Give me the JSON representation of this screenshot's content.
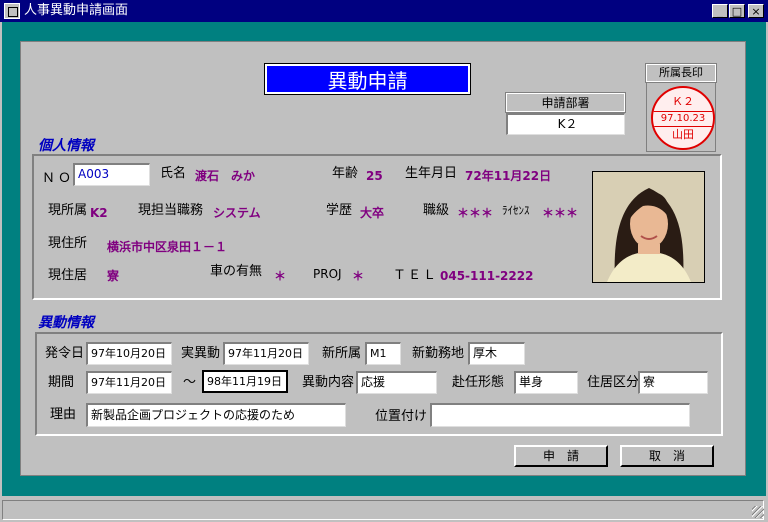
{
  "window": {
    "title": "人事異動申請画面",
    "controls": {
      "minimize": "_",
      "maximize": "□",
      "close": "×"
    }
  },
  "header": {
    "title": "異動申請",
    "dept_label": "申請部署",
    "dept_value": "K２",
    "seal_label": "所属長印",
    "seal": {
      "line1": "Ｋ２",
      "line2": "97.10.23",
      "line3": "山田"
    }
  },
  "personal": {
    "section_title": "個人情報",
    "no_label": "ＮＯ",
    "no_value": "A003",
    "name_label": "氏名",
    "name_value": "渡石　みか",
    "age_label": "年齢",
    "age_value": "25",
    "birth_label": "生年月日",
    "birth_value": "72年11月22日",
    "dept_label": "現所属",
    "dept_value": "K2",
    "role_label": "現担当職務",
    "role_value": "システム",
    "education_label": "学歴",
    "education_value": "大卒",
    "rank_label": "職級",
    "rank_value": "＊＊＊",
    "license_label": "ﾗｲｾﾝｽ",
    "license_value": "＊＊＊",
    "address_label": "現住所",
    "address_value": "横浜市中区泉田１－１",
    "residence_label": "現住居",
    "residence_value": "寮",
    "car_label": "車の有無",
    "car_value": "＊",
    "proj_label": "PROJ",
    "proj_value": "＊",
    "tel_label": "ＴＥＬ",
    "tel_value": "045-111-2222"
  },
  "transfer": {
    "section_title": "異動情報",
    "order_date_label": "発令日",
    "order_date": "97年10月20日",
    "actual_label": "実異動",
    "actual_date": "97年11月20日",
    "new_dept_label": "新所属",
    "new_dept": "M1",
    "new_location_label": "新勤務地",
    "new_location": "厚木",
    "period_label": "期間",
    "period_from": "97年11月20日",
    "tilde": "～",
    "period_to": "98年11月19日",
    "content_label": "異動内容",
    "content": "応援",
    "assign_label": "赴任形態",
    "assign": "単身",
    "housing_label": "住居区分",
    "housing": "寮",
    "reason_label": "理由",
    "reason": "新製品企画プロジェクトの応援のため",
    "position_label": "位置付け",
    "position": ""
  },
  "buttons": {
    "apply": "申　請",
    "cancel": "取　消"
  },
  "colors": {
    "title_bar": "#000080",
    "frame": "#008080",
    "header": "#0000ff",
    "section": "#0000c0",
    "value": "#800080",
    "seal": "#e00000"
  },
  "icons": [
    "app-icon",
    "minimize-icon",
    "maximize-icon",
    "close-icon",
    "resize-grip-icon"
  ]
}
